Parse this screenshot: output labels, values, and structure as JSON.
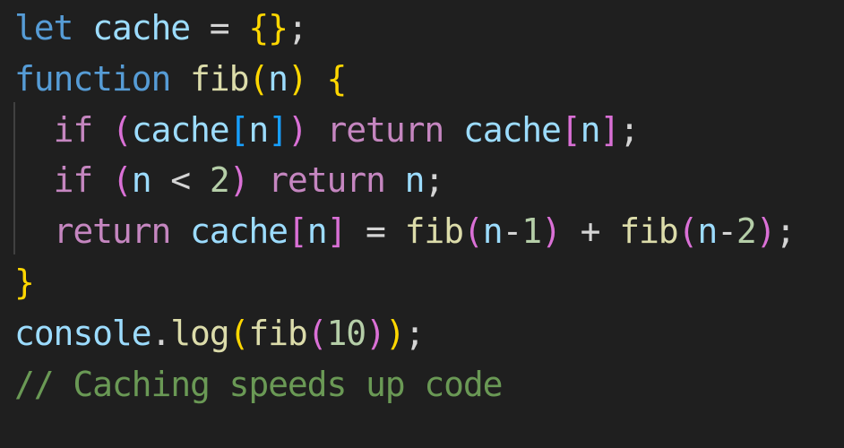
{
  "editor": {
    "theme_colors": {
      "background": "#1f1f1f",
      "keyword": "#569cd6",
      "control": "#c586c0",
      "variable": "#9cdcfe",
      "function": "#dcdcaa",
      "number": "#b5cea8",
      "operator": "#d4d4d4",
      "bracket_1": "#ffd700",
      "bracket_2": "#da70d6",
      "bracket_3": "#179fff",
      "comment": "#6a9955"
    },
    "lines": [
      [
        {
          "t": "let",
          "c": "kw"
        },
        {
          "t": " ",
          "c": "op"
        },
        {
          "t": "cache",
          "c": "var"
        },
        {
          "t": " = ",
          "c": "op"
        },
        {
          "t": "{}",
          "c": "b1"
        },
        {
          "t": ";",
          "c": "op"
        }
      ],
      [
        {
          "t": "function",
          "c": "kw"
        },
        {
          "t": " ",
          "c": "op"
        },
        {
          "t": "fib",
          "c": "fn"
        },
        {
          "t": "(",
          "c": "b1"
        },
        {
          "t": "n",
          "c": "var"
        },
        {
          "t": ")",
          "c": "b1"
        },
        {
          "t": " ",
          "c": "op"
        },
        {
          "t": "{",
          "c": "b1"
        }
      ],
      [
        {
          "t": "  ",
          "c": "op"
        },
        {
          "t": "if",
          "c": "ctrl"
        },
        {
          "t": " ",
          "c": "op"
        },
        {
          "t": "(",
          "c": "b2"
        },
        {
          "t": "cache",
          "c": "var"
        },
        {
          "t": "[",
          "c": "b3"
        },
        {
          "t": "n",
          "c": "var"
        },
        {
          "t": "]",
          "c": "b3"
        },
        {
          "t": ")",
          "c": "b2"
        },
        {
          "t": " ",
          "c": "op"
        },
        {
          "t": "return",
          "c": "ctrl"
        },
        {
          "t": " ",
          "c": "op"
        },
        {
          "t": "cache",
          "c": "var"
        },
        {
          "t": "[",
          "c": "b2"
        },
        {
          "t": "n",
          "c": "var"
        },
        {
          "t": "]",
          "c": "b2"
        },
        {
          "t": ";",
          "c": "op"
        }
      ],
      [
        {
          "t": "  ",
          "c": "op"
        },
        {
          "t": "if",
          "c": "ctrl"
        },
        {
          "t": " ",
          "c": "op"
        },
        {
          "t": "(",
          "c": "b2"
        },
        {
          "t": "n",
          "c": "var"
        },
        {
          "t": " < ",
          "c": "op"
        },
        {
          "t": "2",
          "c": "num"
        },
        {
          "t": ")",
          "c": "b2"
        },
        {
          "t": " ",
          "c": "op"
        },
        {
          "t": "return",
          "c": "ctrl"
        },
        {
          "t": " ",
          "c": "op"
        },
        {
          "t": "n",
          "c": "var"
        },
        {
          "t": ";",
          "c": "op"
        }
      ],
      [
        {
          "t": "  ",
          "c": "op"
        },
        {
          "t": "return",
          "c": "ctrl"
        },
        {
          "t": " ",
          "c": "op"
        },
        {
          "t": "cache",
          "c": "var"
        },
        {
          "t": "[",
          "c": "b2"
        },
        {
          "t": "n",
          "c": "var"
        },
        {
          "t": "]",
          "c": "b2"
        },
        {
          "t": " = ",
          "c": "op"
        },
        {
          "t": "fib",
          "c": "fn"
        },
        {
          "t": "(",
          "c": "b2"
        },
        {
          "t": "n",
          "c": "var"
        },
        {
          "t": "-",
          "c": "op"
        },
        {
          "t": "1",
          "c": "num"
        },
        {
          "t": ")",
          "c": "b2"
        },
        {
          "t": " + ",
          "c": "op"
        },
        {
          "t": "fib",
          "c": "fn"
        },
        {
          "t": "(",
          "c": "b2"
        },
        {
          "t": "n",
          "c": "var"
        },
        {
          "t": "-",
          "c": "op"
        },
        {
          "t": "2",
          "c": "num"
        },
        {
          "t": ")",
          "c": "b2"
        },
        {
          "t": ";",
          "c": "op"
        }
      ],
      [
        {
          "t": "}",
          "c": "b1"
        }
      ],
      [
        {
          "t": "console",
          "c": "var"
        },
        {
          "t": ".",
          "c": "op"
        },
        {
          "t": "log",
          "c": "fn"
        },
        {
          "t": "(",
          "c": "b1"
        },
        {
          "t": "fib",
          "c": "fn"
        },
        {
          "t": "(",
          "c": "b2"
        },
        {
          "t": "10",
          "c": "num"
        },
        {
          "t": ")",
          "c": "b2"
        },
        {
          "t": ")",
          "c": "b1"
        },
        {
          "t": ";",
          "c": "op"
        }
      ],
      [
        {
          "t": "// Caching speeds up code",
          "c": "cm"
        }
      ]
    ]
  }
}
